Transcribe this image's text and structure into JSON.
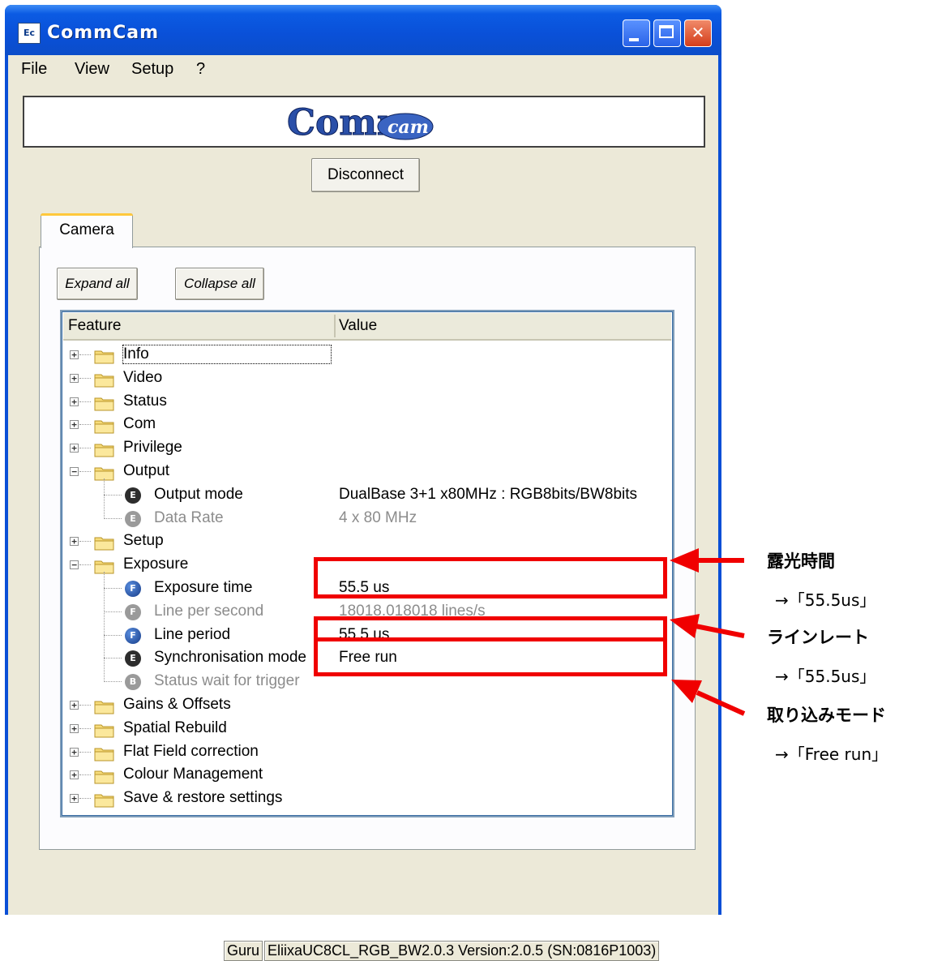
{
  "window": {
    "title": "CommCam",
    "app_icon_text": "Ec",
    "controls": {
      "minimize": "minimize",
      "maximize": "maximize",
      "close": "✕"
    }
  },
  "menu": [
    "File",
    "View",
    "Setup",
    "?"
  ],
  "banner": {
    "logo_text": "Comm",
    "logo_sub": "cam"
  },
  "disconnect_label": "Disconnect",
  "tabs": [
    "Camera"
  ],
  "buttons": {
    "expand_all": "Expand all",
    "collapse_all": "Collapse all"
  },
  "columns": {
    "feature": "Feature",
    "value": "Value"
  },
  "tree": [
    {
      "label": "Info",
      "type": "folder",
      "state": "collapsed"
    },
    {
      "label": "Video",
      "type": "folder",
      "state": "collapsed"
    },
    {
      "label": "Status",
      "type": "folder",
      "state": "collapsed"
    },
    {
      "label": "Com",
      "type": "folder",
      "state": "collapsed"
    },
    {
      "label": "Privilege",
      "type": "folder",
      "state": "collapsed"
    },
    {
      "label": "Output",
      "type": "folder",
      "state": "expanded"
    },
    {
      "label": "Output mode",
      "type": "enum",
      "value": "DualBase 3+1 x80MHz : RGB8bits/BW8bits"
    },
    {
      "label": "Data Rate",
      "type": "enum",
      "value": "4 x 80 MHz",
      "disabled": true
    },
    {
      "label": "Setup",
      "type": "folder",
      "state": "collapsed"
    },
    {
      "label": "Exposure",
      "type": "folder",
      "state": "expanded"
    },
    {
      "label": "Exposure time",
      "type": "float",
      "value": "55.5 us"
    },
    {
      "label": "Line per second",
      "type": "float",
      "value": "18018.018018 lines/s",
      "disabled": true
    },
    {
      "label": "Line period",
      "type": "float",
      "value": "55.5 us"
    },
    {
      "label": "Synchronisation mode",
      "type": "enum",
      "value": "Free run"
    },
    {
      "label": "Status wait for trigger",
      "type": "bool",
      "value": "",
      "disabled": true
    },
    {
      "label": "Gains & Offsets",
      "type": "folder",
      "state": "collapsed"
    },
    {
      "label": "Spatial Rebuild",
      "type": "folder",
      "state": "collapsed"
    },
    {
      "label": "Flat Field correction",
      "type": "folder",
      "state": "collapsed"
    },
    {
      "label": "Colour Management",
      "type": "folder",
      "state": "collapsed"
    },
    {
      "label": "Save & restore settings",
      "type": "folder",
      "state": "collapsed"
    }
  ],
  "status_bar": [
    "Guru",
    "EliixaUC8CL_RGB_BW2.0.3 Version:2.0.5 (SN:0816P1003)"
  ],
  "annotations": {
    "exposure_title": "露光時間",
    "exposure_value": "→「55.5us」",
    "linerate_title": "ラインレート",
    "linerate_value": "→「55.5us」",
    "mode_title": "取り込みモード",
    "mode_value": "→「Free run」",
    "color": "#f00000"
  },
  "colors": {
    "titlebar": "#0a50d8",
    "client": "#ece9d8",
    "tree_border": "#7f9db9"
  }
}
